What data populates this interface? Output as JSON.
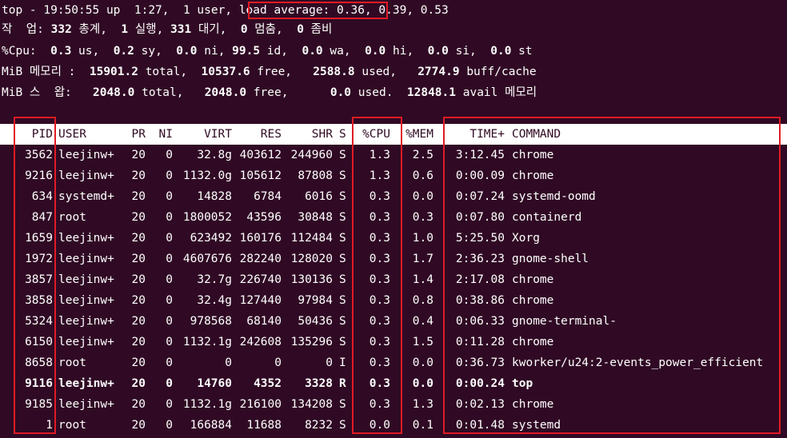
{
  "summary": {
    "top_prefix": "top - 19:50:55 up  1:27,  1 user, ",
    "load_label": "load average: 0.36",
    "load_rest": ", 0.39, 0.53",
    "tasks_pre": "작  업: ",
    "tasks_total": "332",
    "tasks_total_lbl": " 총계,  ",
    "tasks_running": "1",
    "tasks_running_lbl": " 실행, ",
    "tasks_sleeping": "331",
    "tasks_sleeping_lbl": " 대기,  ",
    "tasks_stopped": "0",
    "tasks_stopped_lbl": " 멈춤,  ",
    "tasks_zombie": "0",
    "tasks_zombie_lbl": " 좀비",
    "cpu_pre": "%Cpu:  ",
    "cpu_us": "0.3",
    "cpu_us_lbl": " us,  ",
    "cpu_sy": "0.2",
    "cpu_sy_lbl": " sy,  ",
    "cpu_ni": "0.0",
    "cpu_ni_lbl": " ni, ",
    "cpu_id": "99.5",
    "cpu_id_lbl": " id,  ",
    "cpu_wa": "0.0",
    "cpu_wa_lbl": " wa,  ",
    "cpu_hi": "0.0",
    "cpu_hi_lbl": " hi,  ",
    "cpu_si": "0.0",
    "cpu_si_lbl": " si,  ",
    "cpu_st": "0.0",
    "cpu_st_lbl": " st",
    "mem_pre": "MiB 메모리 :  ",
    "mem_total": "15901.2",
    "mem_total_lbl": " total,  ",
    "mem_free": "10537.6",
    "mem_free_lbl": " free,   ",
    "mem_used": "2588.8",
    "mem_used_lbl": " used,   ",
    "mem_cache": "2774.9",
    "mem_cache_lbl": " buff/cache",
    "swap_pre": "MiB 스  왑:   ",
    "swap_total": "2048.0",
    "swap_total_lbl": " total,   ",
    "swap_free": "2048.0",
    "swap_free_lbl": " free,      ",
    "swap_used": "0.0",
    "swap_used_lbl": " used.  ",
    "swap_avail": "12848.1",
    "swap_avail_lbl": " avail 메모리"
  },
  "columns": {
    "pid": "PID",
    "user": "USER",
    "pr": "PR",
    "ni": "NI",
    "virt": "VIRT",
    "res": "RES",
    "shr": "SHR",
    "s": "S",
    "cpu": "%CPU",
    "mem": "%MEM",
    "time": "TIME+",
    "command": "COMMAND"
  },
  "processes": [
    {
      "pid": "3562",
      "user": "leejinw+",
      "pr": "20",
      "ni": "0",
      "virt": "32.8g",
      "res": "403612",
      "shr": "244960",
      "s": "S",
      "cpu": "1.3",
      "mem": "2.5",
      "time": "3:12.45",
      "command": "chrome"
    },
    {
      "pid": "9216",
      "user": "leejinw+",
      "pr": "20",
      "ni": "0",
      "virt": "1132.0g",
      "res": "105612",
      "shr": "87808",
      "s": "S",
      "cpu": "1.3",
      "mem": "0.6",
      "time": "0:00.09",
      "command": "chrome"
    },
    {
      "pid": "634",
      "user": "systemd+",
      "pr": "20",
      "ni": "0",
      "virt": "14828",
      "res": "6784",
      "shr": "6016",
      "s": "S",
      "cpu": "0.3",
      "mem": "0.0",
      "time": "0:07.24",
      "command": "systemd-oomd"
    },
    {
      "pid": "847",
      "user": "root",
      "pr": "20",
      "ni": "0",
      "virt": "1800052",
      "res": "43596",
      "shr": "30848",
      "s": "S",
      "cpu": "0.3",
      "mem": "0.3",
      "time": "0:07.80",
      "command": "containerd"
    },
    {
      "pid": "1659",
      "user": "leejinw+",
      "pr": "20",
      "ni": "0",
      "virt": "623492",
      "res": "160176",
      "shr": "112484",
      "s": "S",
      "cpu": "0.3",
      "mem": "1.0",
      "time": "5:25.50",
      "command": "Xorg"
    },
    {
      "pid": "1972",
      "user": "leejinw+",
      "pr": "20",
      "ni": "0",
      "virt": "4607676",
      "res": "282240",
      "shr": "128020",
      "s": "S",
      "cpu": "0.3",
      "mem": "1.7",
      "time": "2:36.23",
      "command": "gnome-shell"
    },
    {
      "pid": "3857",
      "user": "leejinw+",
      "pr": "20",
      "ni": "0",
      "virt": "32.7g",
      "res": "226740",
      "shr": "130136",
      "s": "S",
      "cpu": "0.3",
      "mem": "1.4",
      "time": "2:17.08",
      "command": "chrome"
    },
    {
      "pid": "3858",
      "user": "leejinw+",
      "pr": "20",
      "ni": "0",
      "virt": "32.4g",
      "res": "127440",
      "shr": "97984",
      "s": "S",
      "cpu": "0.3",
      "mem": "0.8",
      "time": "0:38.86",
      "command": "chrome"
    },
    {
      "pid": "5324",
      "user": "leejinw+",
      "pr": "20",
      "ni": "0",
      "virt": "978568",
      "res": "68140",
      "shr": "50436",
      "s": "S",
      "cpu": "0.3",
      "mem": "0.4",
      "time": "0:06.33",
      "command": "gnome-terminal-"
    },
    {
      "pid": "6150",
      "user": "leejinw+",
      "pr": "20",
      "ni": "0",
      "virt": "1132.1g",
      "res": "242608",
      "shr": "135296",
      "s": "S",
      "cpu": "0.3",
      "mem": "1.5",
      "time": "0:11.28",
      "command": "chrome"
    },
    {
      "pid": "8658",
      "user": "root",
      "pr": "20",
      "ni": "0",
      "virt": "0",
      "res": "0",
      "shr": "0",
      "s": "I",
      "cpu": "0.3",
      "mem": "0.0",
      "time": "0:36.73",
      "command": "kworker/u24:2-events_power_efficient"
    },
    {
      "pid": "9116",
      "user": "leejinw+",
      "pr": "20",
      "ni": "0",
      "virt": "14760",
      "res": "4352",
      "shr": "3328",
      "s": "R",
      "cpu": "0.3",
      "mem": "0.0",
      "time": "0:00.24",
      "command": "top",
      "bold": true
    },
    {
      "pid": "9185",
      "user": "leejinw+",
      "pr": "20",
      "ni": "0",
      "virt": "1132.1g",
      "res": "216100",
      "shr": "134208",
      "s": "S",
      "cpu": "0.3",
      "mem": "1.3",
      "time": "0:02.13",
      "command": "chrome"
    },
    {
      "pid": "1",
      "user": "root",
      "pr": "20",
      "ni": "0",
      "virt": "166884",
      "res": "11688",
      "shr": "8232",
      "s": "S",
      "cpu": "0.0",
      "mem": "0.1",
      "time": "0:01.48",
      "command": "systemd"
    }
  ],
  "colors": {
    "background": "#300a24",
    "foreground": "#ffffff",
    "highlight_box": "#e01b24"
  }
}
